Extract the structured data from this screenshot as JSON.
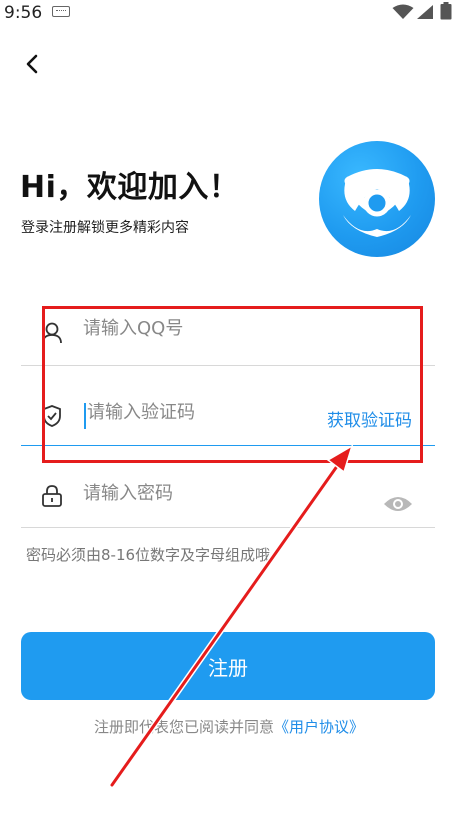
{
  "status_bar": {
    "time": "9:56"
  },
  "header": {
    "title": "Hi，欢迎加入！",
    "subtitle": "登录注册解锁更多精彩内容"
  },
  "form": {
    "qq": {
      "placeholder": "请输入QQ号",
      "icon": "user-icon"
    },
    "code": {
      "placeholder": "请输入验证码",
      "icon": "shield-icon",
      "action_label": "获取验证码"
    },
    "password": {
      "placeholder": "请输入密码",
      "icon": "lock-icon",
      "toggle_icon": "eye-icon"
    },
    "hint": "密码必须由8-16位数字及字母组成哦"
  },
  "register_label": "注册",
  "agreement": {
    "prefix": "注册即代表您已阅读并同意",
    "link": "《用户协议》"
  },
  "colors": {
    "accent": "#1f9bf0",
    "annotation": "#e51c1c"
  }
}
